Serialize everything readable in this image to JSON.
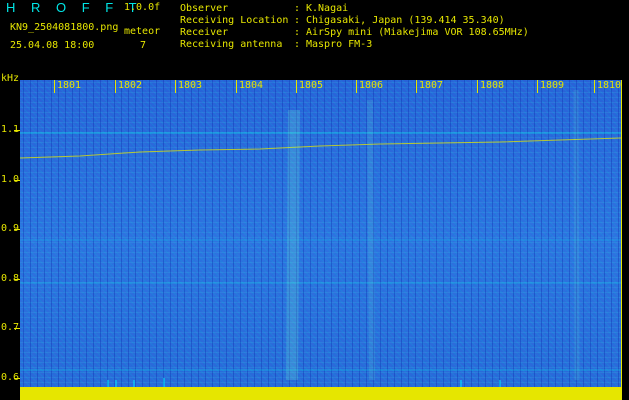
{
  "app": {
    "brand": "H R O F F T",
    "version": "1.0.0f",
    "filename": "KN9_2504081800.png",
    "mode": "meteor",
    "datetime": "25.04.08 18:00",
    "count": "7"
  },
  "meta": {
    "rows": [
      {
        "label": "Observer",
        "value": "K.Nagai"
      },
      {
        "label": "Receiving Location",
        "value": "Chigasaki, Japan (139.414 35.340)"
      },
      {
        "label": "Receiver",
        "value": "AirSpy mini (Miakejima VOR 108.65MHz)"
      },
      {
        "label": "Receiving antenna",
        "value": "Maspro FM-3"
      }
    ]
  },
  "axes": {
    "unit": "kHz",
    "y_ticks": [
      "1.1",
      "1.0",
      "0.9",
      "0.8",
      "0.7",
      "0.6"
    ],
    "x_ticks": [
      "1801",
      "1802",
      "1803",
      "1804",
      "1805",
      "1806",
      "1807",
      "1808",
      "1809",
      "1810"
    ]
  },
  "colors": {
    "text": "#e6e600",
    "brand": "#00e6e6",
    "noise": "#2a62d8",
    "trace": "#e6e600",
    "band": "#e6e600"
  }
}
